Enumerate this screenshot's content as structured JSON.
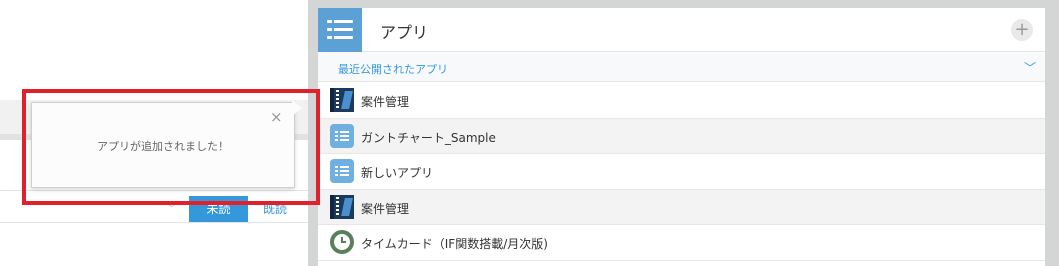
{
  "left_background": {
    "primary_button": "未読",
    "link_button": "既読"
  },
  "panel": {
    "title": "アプリ",
    "add_button": "+",
    "section": {
      "label": "最近公開されたアプリ",
      "chevron": "﹀"
    },
    "apps": [
      {
        "name": "案件管理",
        "icon": "book-icon"
      },
      {
        "name": "ガントチャート_Sample",
        "icon": "list-app-icon"
      },
      {
        "name": "新しいアプリ",
        "icon": "list-app-icon"
      },
      {
        "name": "案件管理",
        "icon": "book-icon"
      },
      {
        "name": "タイムカード（IF関数搭載/月次版)",
        "icon": "clock-icon"
      }
    ]
  },
  "toast": {
    "message": "アプリが追加されました！",
    "close": "×"
  },
  "colors": {
    "accent": "#3498db",
    "header_icon_bg": "#5ba1d6",
    "highlight": "#e0202a",
    "frame": "#d4d6d6"
  }
}
